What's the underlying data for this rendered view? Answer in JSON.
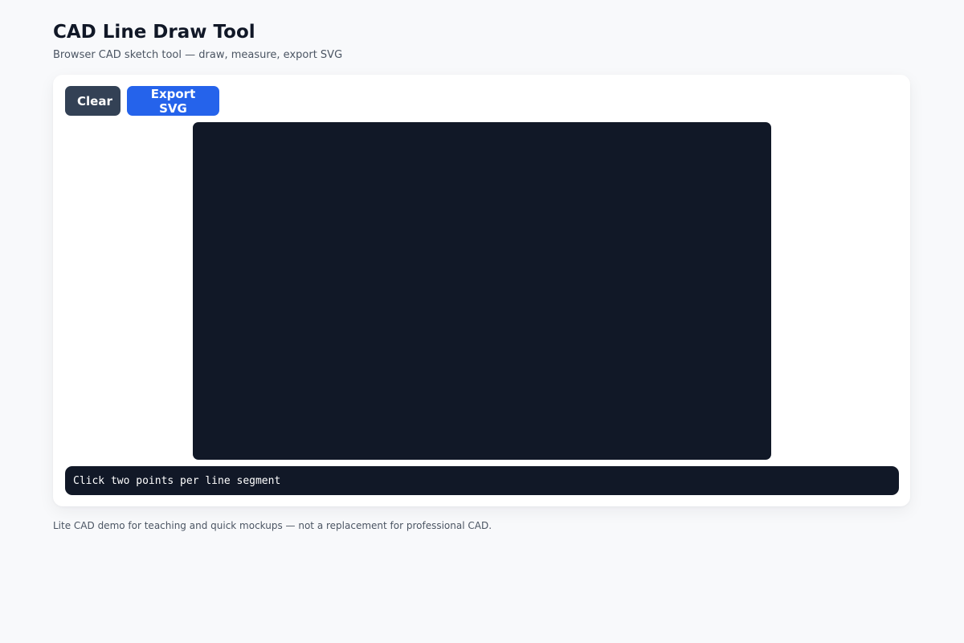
{
  "header": {
    "title": "CAD Line Draw Tool",
    "subtitle": "Browser CAD sketch tool — draw, measure, export SVG"
  },
  "toolbar": {
    "clear_label": "Clear",
    "export_label": "Export SVG"
  },
  "status": {
    "text": "Click two points per line segment"
  },
  "footer": {
    "text": "Lite CAD demo for teaching and quick mockups — not a replacement for professional CAD."
  },
  "colors": {
    "page_background": "#f8f9fb",
    "canvas_background": "#111827",
    "clear_button": "#334155",
    "export_button": "#2563eb"
  }
}
